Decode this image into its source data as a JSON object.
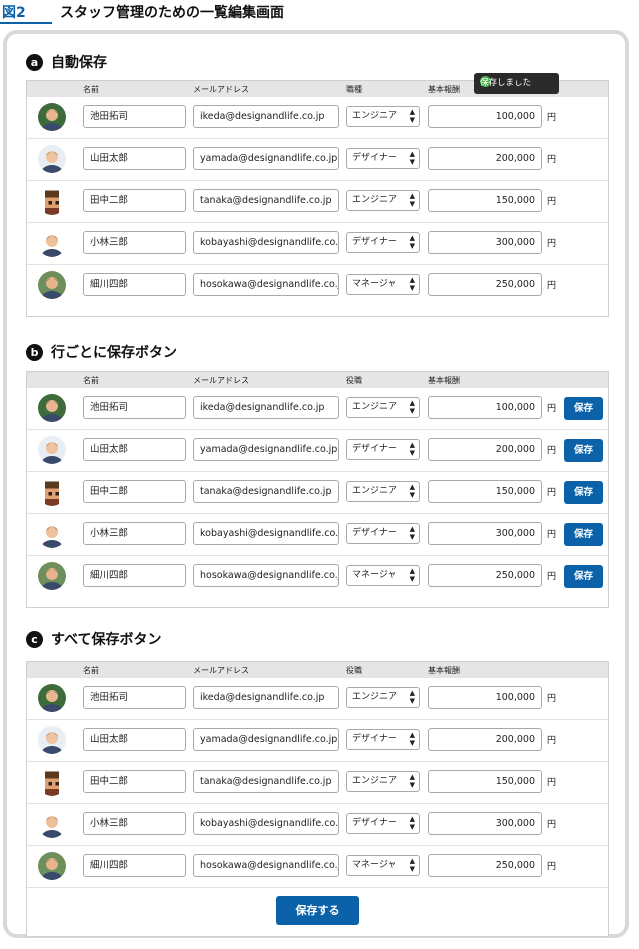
{
  "figure": {
    "number": "図2",
    "title": "スタッフ管理のための一覧編集画面"
  },
  "columns": {
    "name": "名前",
    "mail": "メールアドレス",
    "role_a": "職種",
    "role_bc": "役職",
    "salary": "基本報酬"
  },
  "tooltip": "保存しました",
  "currency": "円",
  "sections": {
    "a": {
      "badge": "a",
      "title": "自動保存"
    },
    "b": {
      "badge": "b",
      "title": "行ごとに保存ボタン",
      "row_button": "保存"
    },
    "c": {
      "badge": "c",
      "title": "すべて保存ボタン",
      "save_all": "保存する"
    }
  },
  "staff": [
    {
      "name": "池田拓司",
      "email": "ikeda@designandlife.co.jp",
      "role": "エンジニア",
      "salary": "100,000",
      "avatar": "avatar-photo"
    },
    {
      "name": "山田太郎",
      "email": "yamada@designandlife.co.jp",
      "role": "デザイナー",
      "salary": "200,000",
      "avatar": "avatar-photo"
    },
    {
      "name": "田中二郎",
      "email": "tanaka@designandlife.co.jp",
      "role": "エンジニア",
      "salary": "150,000",
      "avatar": "avatar-pixel"
    },
    {
      "name": "小林三郎",
      "email": "kobayashi@designandlife.co.jp",
      "role": "デザイナー",
      "salary": "300,000",
      "avatar": "avatar-photo"
    },
    {
      "name": "細川四郎",
      "email": "hosokawa@designandlife.co.jp",
      "role": "マネージャ",
      "salary": "250,000",
      "avatar": "avatar-photo"
    }
  ],
  "colors": {
    "accent": "#0b62a8",
    "tooltip_bg": "#2a2a2a",
    "success": "#4caf50"
  }
}
